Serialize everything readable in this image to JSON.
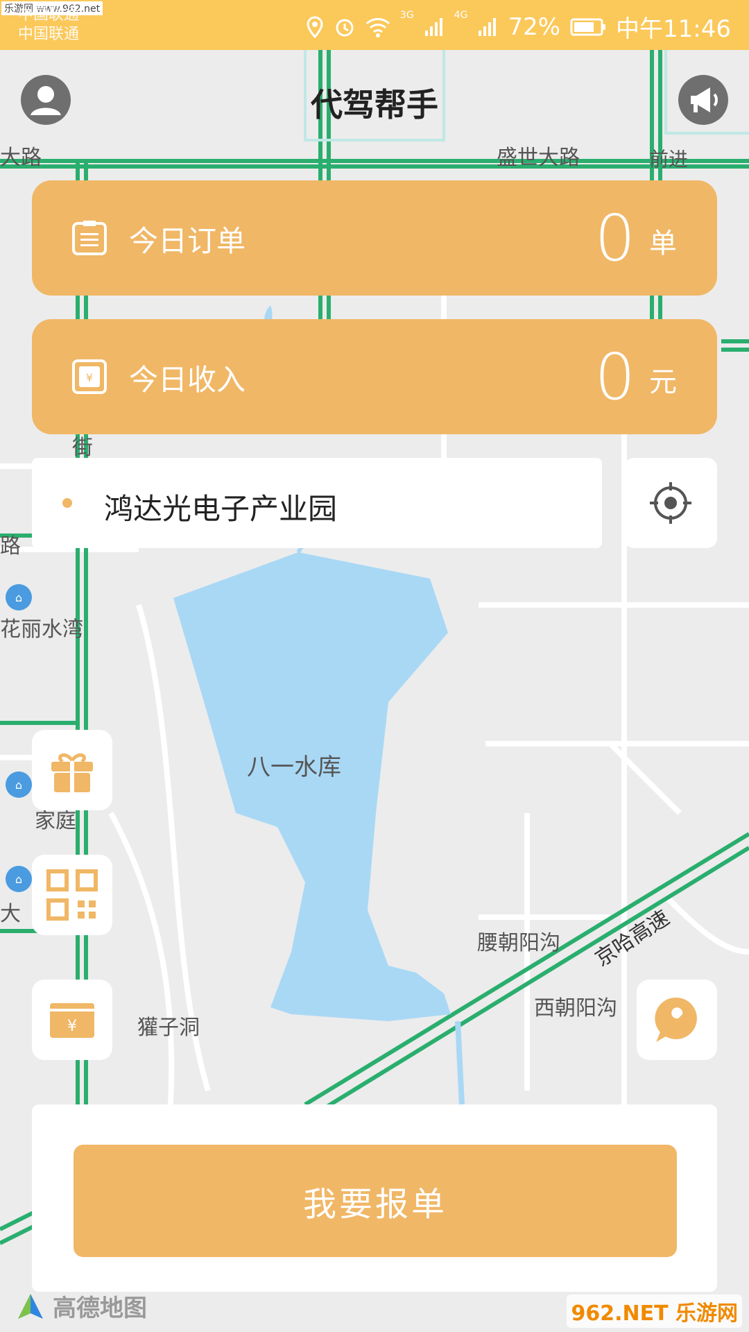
{
  "status_bar": {
    "carrier_1": "中国联通",
    "carrier_2": "中国联通",
    "watermark": "乐游网 www.962.net",
    "battery": "72%",
    "time": "中午11:46",
    "net_1": "3G",
    "net_2": "4G"
  },
  "header": {
    "title": "代驾帮手",
    "avatar_icon": "user-avatar-icon",
    "notice_icon": "megaphone-icon"
  },
  "stats": {
    "orders": {
      "label": "今日订单",
      "value": "0",
      "unit": "单",
      "icon": "clipboard-icon"
    },
    "income": {
      "label": "今日收入",
      "value": "0",
      "unit": "元",
      "icon": "yuan-ticket-icon"
    }
  },
  "location": {
    "address": "鸿达光电子产业园",
    "locate_icon": "locate-icon"
  },
  "map": {
    "labels": [
      "盛世大路",
      "八一水库",
      "腰朝阳沟",
      "京哈高速",
      "西朝阳沟",
      "獾子洞",
      "街",
      "路",
      "花丽水湾",
      "家庭",
      "大",
      "前进",
      "大路"
    ]
  },
  "side_buttons": [
    "gift-icon",
    "qr-code-icon",
    "wallet-icon"
  ],
  "tool_button": "wrench-chat-icon",
  "bottom": {
    "report_button": "我要报单"
  },
  "footer": {
    "amap_logo": "高德地图",
    "watermark": "962.NET 乐游网"
  },
  "colors": {
    "accent": "#f0b766",
    "statusbar": "#fbc85a",
    "water": "#a9d8f5",
    "road_green": "#2aae6e"
  }
}
